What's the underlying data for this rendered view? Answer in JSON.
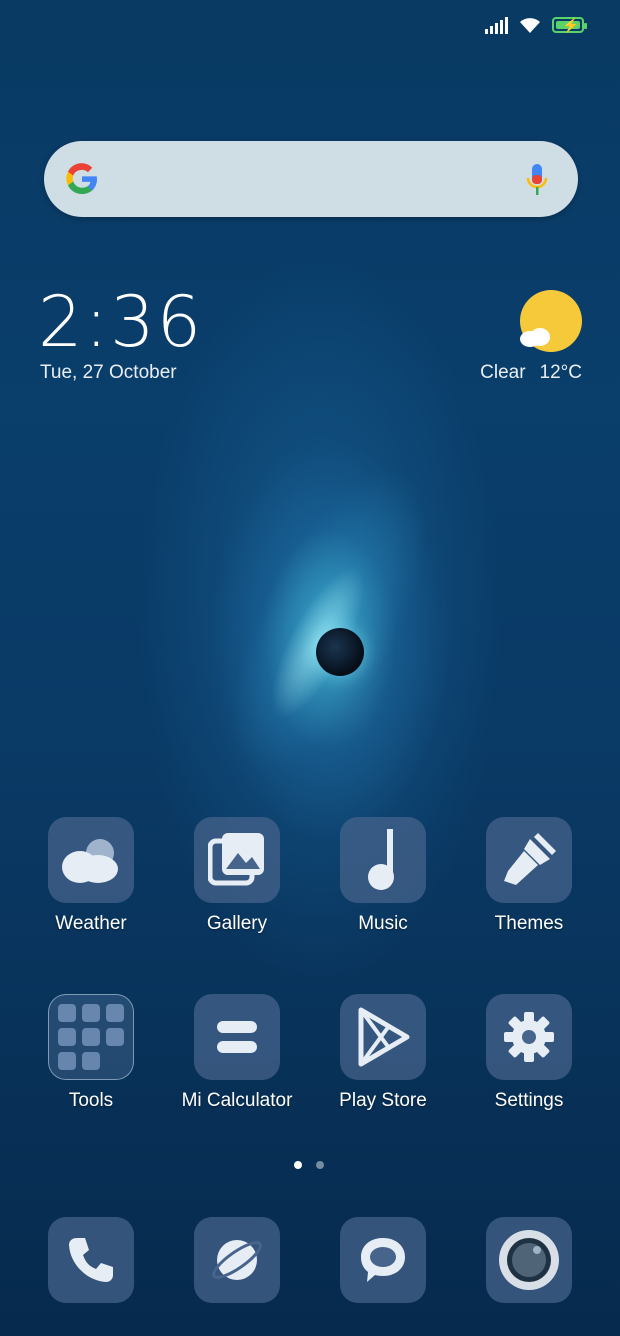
{
  "status_bar": {
    "icons": [
      "signal-icon",
      "wifi-icon",
      "battery-charging-icon"
    ]
  },
  "search": {
    "logo": "google-logo",
    "mic_icon": "mic-icon"
  },
  "clock": {
    "time": "2:36",
    "date": "Tue, 27 October"
  },
  "weather": {
    "condition": "Clear",
    "temperature": "12°C",
    "icon": "sun-cloud-icon"
  },
  "apps_row1": [
    {
      "label": "Weather",
      "icon": "weather-icon"
    },
    {
      "label": "Gallery",
      "icon": "gallery-icon"
    },
    {
      "label": "Music",
      "icon": "music-icon"
    },
    {
      "label": "Themes",
      "icon": "brush-icon"
    }
  ],
  "apps_row2": [
    {
      "label": "Tools",
      "icon": "folder-icon"
    },
    {
      "label": "Mi Calculator",
      "icon": "calculator-icon"
    },
    {
      "label": "Play Store",
      "icon": "play-store-icon"
    },
    {
      "label": "Settings",
      "icon": "gear-icon"
    }
  ],
  "page_indicator": {
    "count": 2,
    "active": 1
  },
  "dock": [
    {
      "icon": "phone-icon"
    },
    {
      "icon": "browser-icon"
    },
    {
      "icon": "messages-icon"
    },
    {
      "icon": "camera-icon"
    }
  ],
  "colors": {
    "background": "#0a3e6b",
    "sun": "#f6c93a",
    "icon_tile": "#46648c",
    "battery": "#5ad46a"
  }
}
